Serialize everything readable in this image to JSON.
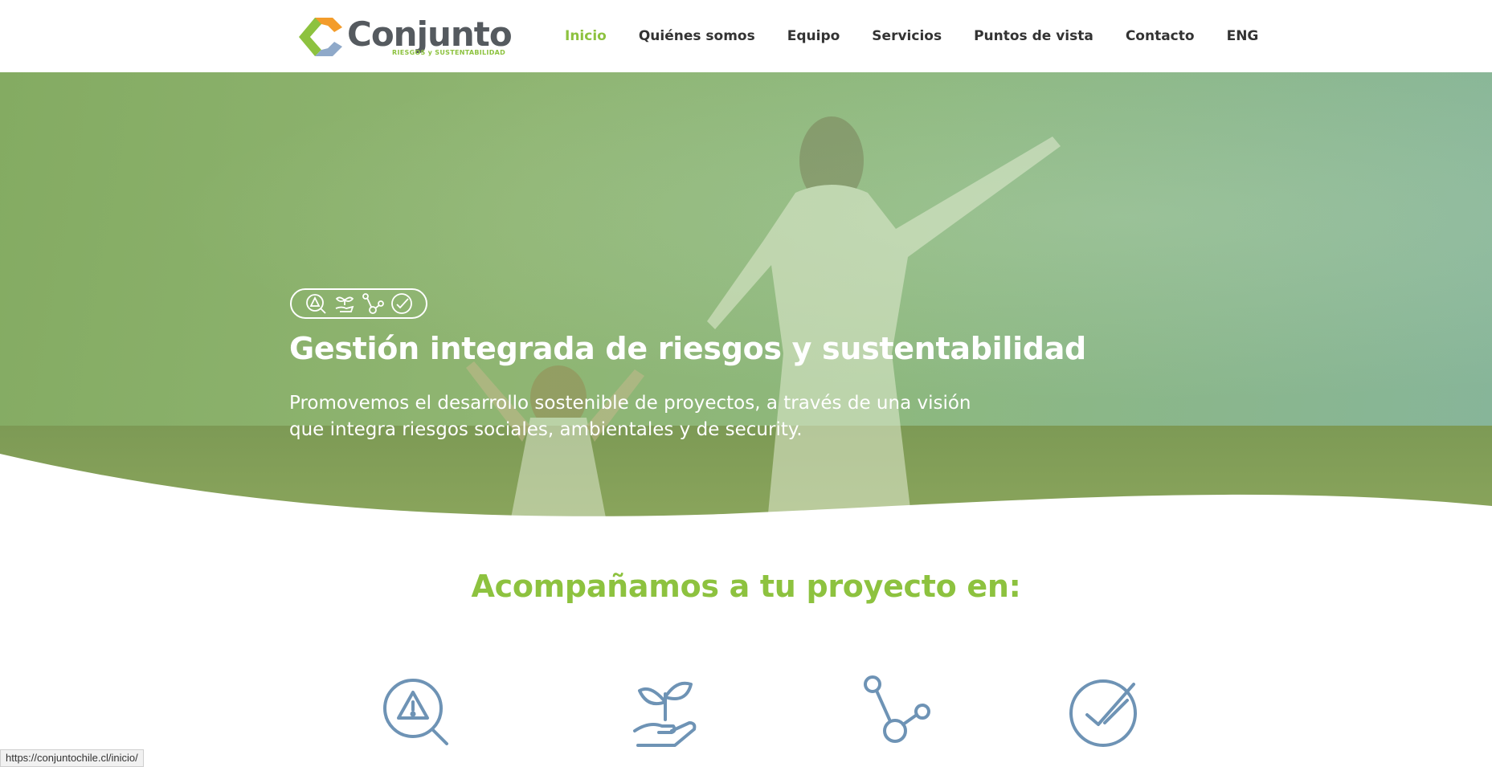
{
  "header": {
    "logo": {
      "word": "Conjunto",
      "tagline": "RIESGOS y SUSTENTABILIDAD",
      "colors": [
        "#f39c2b",
        "#8dc23f",
        "#8fa9c9"
      ]
    },
    "nav": [
      {
        "label": "Inicio",
        "active": true
      },
      {
        "label": "Quiénes somos",
        "active": false
      },
      {
        "label": "Equipo",
        "active": false
      },
      {
        "label": "Servicios",
        "active": false
      },
      {
        "label": "Puntos de vista",
        "active": false
      },
      {
        "label": "Contacto",
        "active": false
      },
      {
        "label": "ENG",
        "active": false
      }
    ]
  },
  "hero": {
    "badge_icons": [
      "warning-search-icon",
      "plant-hand-icon",
      "network-icon",
      "check-circle-icon"
    ],
    "title": "Gestión integrada de riesgos y sustentabilidad",
    "subtitle_line1": "Promovemos el desarrollo sostenible de proyectos, a través de una visión",
    "subtitle_line2": "que integra riesgos sociales, ambientales y de security."
  },
  "section": {
    "title": "Acompañamos a tu proyecto en:",
    "icons": [
      "warning-search-icon",
      "plant-hand-icon",
      "network-icon",
      "check-circle-icon"
    ],
    "icon_color": "#6e93b5"
  },
  "statusbar": {
    "url": "https://conjuntochile.cl/inicio/"
  },
  "colors": {
    "accent": "#8dc23f",
    "nav_text": "#333333",
    "icon_blue": "#6e93b5"
  }
}
